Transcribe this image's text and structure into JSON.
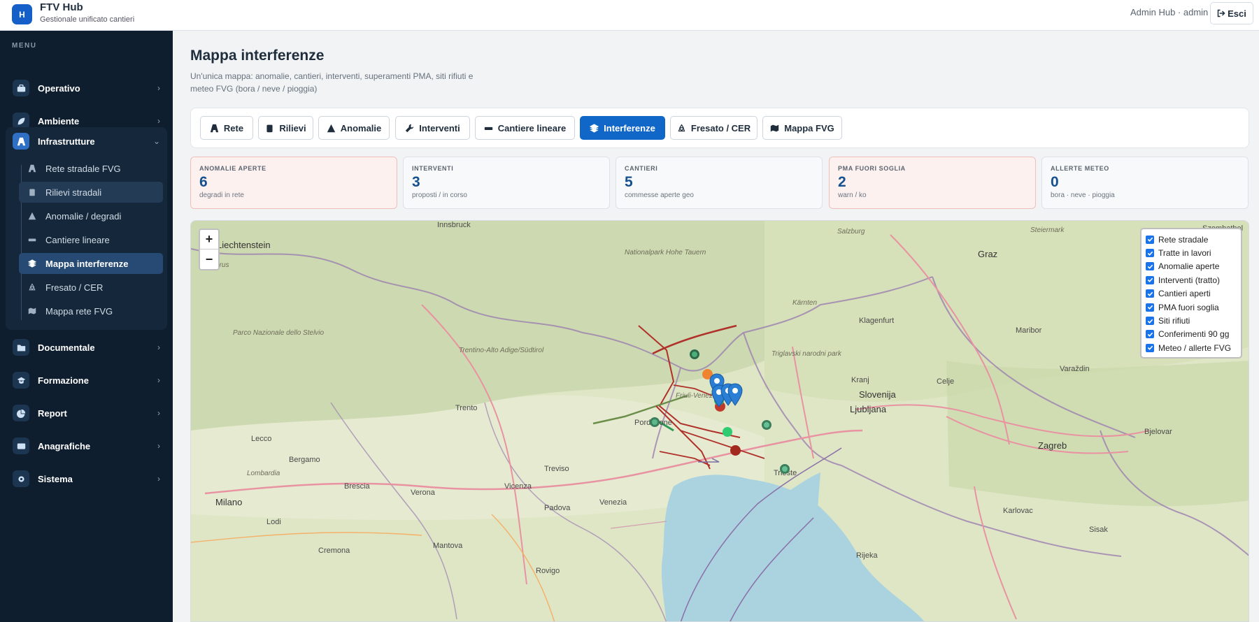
{
  "header": {
    "logo_letter": "H",
    "title": "FTV Hub",
    "subtitle": "Gestionale unificato cantieri",
    "user": "Admin Hub · admin",
    "logout_label": "Esci"
  },
  "sidebar": {
    "menu_label": "MENU",
    "items": [
      {
        "label": "Operativo",
        "icon": "briefcase-icon"
      },
      {
        "label": "Ambiente",
        "icon": "leaf-icon"
      },
      {
        "label": "Infrastrutture",
        "icon": "road-icon"
      },
      {
        "label": "Documentale",
        "icon": "folder-icon"
      },
      {
        "label": "Formazione",
        "icon": "graduation-cap-icon"
      },
      {
        "label": "Report",
        "icon": "pie-chart-icon"
      },
      {
        "label": "Anagrafiche",
        "icon": "id-card-icon"
      },
      {
        "label": "Sistema",
        "icon": "gear-icon"
      }
    ],
    "infra_sub": [
      {
        "label": "Rete stradale FVG",
        "icon": "road-icon"
      },
      {
        "label": "Rilievi stradali",
        "icon": "clipboard-icon"
      },
      {
        "label": "Anomalie / degradi",
        "icon": "warning-icon"
      },
      {
        "label": "Cantiere lineare",
        "icon": "ruler-icon"
      },
      {
        "label": "Mappa interferenze",
        "icon": "layers-icon"
      },
      {
        "label": "Fresato / CER",
        "icon": "recycle-icon"
      },
      {
        "label": "Mappa rete FVG",
        "icon": "map-icon"
      }
    ]
  },
  "page": {
    "title": "Mappa interferenze",
    "description": "Un'unica mappa: anomalie, cantieri, interventi, superamenti PMA, siti rifiuti e meteo FVG (bora / neve / pioggia)"
  },
  "tabs": [
    {
      "label": "Rete",
      "icon": "road-icon"
    },
    {
      "label": "Rilievi",
      "icon": "clipboard-icon"
    },
    {
      "label": "Anomalie",
      "icon": "warning-icon"
    },
    {
      "label": "Interventi",
      "icon": "wrench-icon"
    },
    {
      "label": "Cantiere lineare",
      "icon": "ruler-icon"
    },
    {
      "label": "Interferenze",
      "icon": "layers-icon",
      "active": true
    },
    {
      "label": "Fresato / CER",
      "icon": "recycle-icon"
    },
    {
      "label": "Mappa FVG",
      "icon": "map-icon"
    }
  ],
  "stats": [
    {
      "label": "ANOMALIE APERTE",
      "value": "6",
      "sub": "degradi in rete"
    },
    {
      "label": "INTERVENTI",
      "value": "3",
      "sub": "proposti / in corso"
    },
    {
      "label": "CANTIERI",
      "value": "5",
      "sub": "commesse aperte geo"
    },
    {
      "label": "PMA FUORI SOGLIA",
      "value": "2",
      "sub": "warn / ko"
    },
    {
      "label": "ALLERTE METEO",
      "value": "0",
      "sub": "bora · neve · pioggia"
    }
  ],
  "map": {
    "zoom_in": "+",
    "zoom_out": "−",
    "layers": [
      "Rete stradale",
      "Tratte in lavori",
      "Anomalie aperte",
      "Interventi (tratto)",
      "Cantieri aperti",
      "PMA fuori soglia",
      "Siti rifiuti",
      "Conferimenti 90 gg",
      "Meteo / allerte FVG"
    ],
    "place_labels": {
      "innsbruck": "Innsbruck",
      "liechtenstein": "Liechtenstein",
      "graz": "Graz",
      "szombathely": "Szombathel",
      "klagenfurt": "Klagenfurt",
      "maribor": "Maribor",
      "kranj": "Kranj",
      "celje": "Celje",
      "slovenija": "Slovenija",
      "ljubljana": "Ljubljana",
      "zagreb": "Zagreb",
      "varazdin": "Varaždin",
      "bjelovar": "Bjelovar",
      "karlovac": "Karlovac",
      "sisak": "Sisak",
      "rijeka": "Rijeka",
      "trento": "Trento",
      "lecco": "Lecco",
      "bergamo": "Bergamo",
      "brescia": "Brescia",
      "milano": "Milano",
      "lodi": "Lodi",
      "cremona": "Cremona",
      "mantova": "Mantova",
      "verona": "Verona",
      "vicenza": "Vicenza",
      "padova": "Padova",
      "venezia": "Venezia",
      "treviso": "Treviso",
      "rovigo": "Rovigo",
      "pordenone": "Pordenone",
      "trieste": "Trieste",
      "fvg": "Friuli-Venezia Giulia",
      "taa": "Trentino-Alto Adige/Südtirol",
      "lombardia": "Lombardia",
      "kaernten": "Kärnten",
      "steiermark": "Steiermark",
      "salzburg": "Salzburg",
      "glarus": "Glarus",
      "hohetauern": "Nationalpark Hohe Tauern",
      "stelvio": "Parco Nazionale dello Stelvio",
      "triglav": "Triglavski narodni park"
    }
  },
  "colors": {
    "brand": "#1460c8",
    "sidebar_bg": "#0f1e2e",
    "active_tab": "#1167c7",
    "stat_value": "#16518f",
    "warn_bg": "#fdf1f0"
  }
}
